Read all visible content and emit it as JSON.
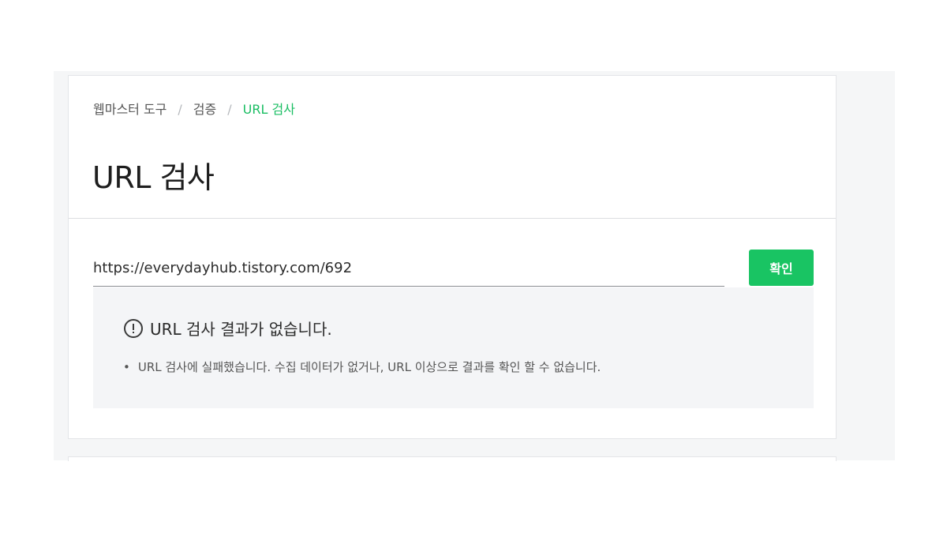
{
  "breadcrumb": {
    "items": [
      "웹마스터 도구",
      "검증"
    ],
    "current": "URL 검사",
    "separator": "/"
  },
  "page": {
    "title": "URL 검사"
  },
  "search": {
    "value": "https://everydayhub.tistory.com/692",
    "button_label": "확인"
  },
  "result": {
    "icon": "exclamation-circle-icon",
    "title": "URL 검사 결과가 없습니다.",
    "details": [
      "URL 검사에 실패했습니다. 수집 데이터가 없거나, URL 이상으로 결과를 확인 할 수 없습니다."
    ]
  },
  "colors": {
    "accent": "#19c463",
    "breadcrumb_current": "#19bd62",
    "result_background": "#f4f5f7",
    "page_background": "#f5f6f7"
  }
}
